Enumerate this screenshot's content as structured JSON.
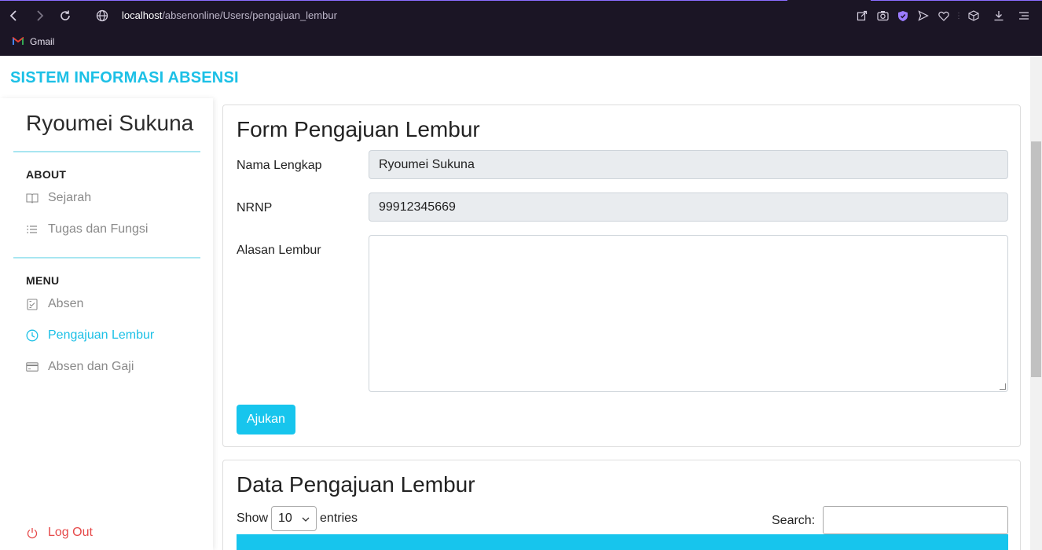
{
  "browser": {
    "url_host": "localhost",
    "url_path": "/absenonline/Users/pengajuan_lembur",
    "bookmark": "Gmail"
  },
  "app": {
    "brand": "SISTEM INFORMASI ABSENSI"
  },
  "sidebar": {
    "profile_name": "Ryoumei Sukuna",
    "about_title": "ABOUT",
    "about_items": [
      {
        "label": "Sejarah",
        "icon": "book-icon"
      },
      {
        "label": "Tugas dan Fungsi",
        "icon": "list-icon"
      }
    ],
    "menu_title": "MENU",
    "menu_items": [
      {
        "label": "Absen",
        "icon": "checklist-icon"
      },
      {
        "label": "Pengajuan Lembur",
        "icon": "clock-icon",
        "active": true
      },
      {
        "label": "Absen dan Gaji",
        "icon": "card-icon"
      }
    ],
    "logout": "Log Out"
  },
  "form": {
    "title": "Form Pengajuan Lembur",
    "name_label": "Nama Lengkap",
    "name_value": "Ryoumei Sukuna",
    "nrnp_label": "NRNP",
    "nrnp_value": "99912345669",
    "reason_label": "Alasan Lembur",
    "reason_value": "",
    "submit": "Ajukan"
  },
  "table": {
    "title": "Data Pengajuan Lembur",
    "show_label": "Show",
    "entries_value": "10",
    "entries_label": "entries",
    "search_label": "Search:"
  },
  "colors": {
    "accent": "#17c5ed",
    "danger": "#e64a4a"
  }
}
